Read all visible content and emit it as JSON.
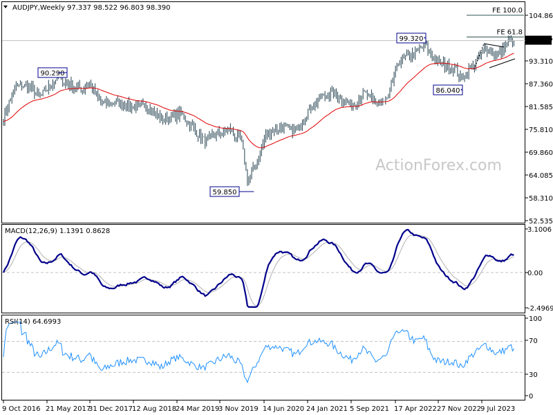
{
  "header": {
    "symbol": "AUDJPY,Weekly",
    "ohlc": "97.337 98.522 96.803 98.390",
    "dropdown_icon": "triangle-down-icon"
  },
  "watermark": "ActionForex.com",
  "colors": {
    "bars": "#24414f",
    "ma": "#e00000",
    "macd": "#00008b",
    "signal": "#b0b0b0",
    "rsi": "#1e90ff",
    "label_border": "#00008b"
  },
  "chart_data": [
    {
      "type": "ohlc",
      "title": "AUDJPY,Weekly",
      "x": [
        "2016-10",
        "2016-12",
        "2017-02",
        "2017-04",
        "2017-07",
        "2017-08",
        "2017-11",
        "2017-12",
        "2018-02",
        "2018-05",
        "2018-08",
        "2018-10",
        "2018-12",
        "2019-03",
        "2019-05",
        "2019-07",
        "2019-09",
        "2019-11",
        "2020-01",
        "2020-02",
        "2020-04",
        "2020-05",
        "2020-07",
        "2020-10",
        "2020-12",
        "2021-02",
        "2021-04",
        "2021-05",
        "2021-07",
        "2021-09",
        "2021-11",
        "2022-01",
        "2022-02",
        "2022-03",
        "2022-05",
        "2022-07",
        "2022-09",
        "2022-12",
        "2023-01",
        "2023-03",
        "2023-05",
        "2023-07",
        "2023-08",
        "2023-09"
      ],
      "close": [
        78.8,
        86.8,
        86.8,
        84.0,
        89.4,
        87.6,
        85.9,
        87.6,
        82.4,
        82.4,
        81.5,
        81.5,
        78.0,
        79.7,
        76.2,
        72.7,
        74.4,
        75.7,
        72.7,
        62.2,
        69.2,
        74.4,
        76.2,
        75.3,
        80.6,
        84.0,
        85.0,
        84.0,
        81.5,
        85.0,
        82.4,
        83.2,
        89.4,
        93.8,
        94.7,
        97.3,
        92.9,
        91.2,
        88.5,
        92.0,
        96.4,
        94.7,
        96.4,
        98.39
      ],
      "overlay": "moving average (red)",
      "ylim": [
        52.535,
        104.86
      ],
      "y_ticks": [
        "104.860",
        "99.285",
        "93.310",
        "87.360",
        "81.585",
        "75.810",
        "69.860",
        "64.085",
        "58.310",
        "52.535"
      ],
      "x_ticks": [
        "9 Oct 2016",
        "21 May 2017",
        "31 Dec 2017",
        "12 Aug 2018",
        "24 Mar 2019",
        "3 Nov 2019",
        "14 Jun 2020",
        "24 Jan 2021",
        "5 Sep 2021",
        "17 Apr 2022",
        "27 Nov 2022",
        "9 Jul 2023"
      ],
      "current_price": "98.390",
      "annotations": [
        {
          "text": "90.290",
          "value": 90.29,
          "date": "2017-07"
        },
        {
          "text": "59.850",
          "value": 59.85,
          "date": "2020-03"
        },
        {
          "text": "99.320",
          "value": 99.32,
          "date": "2022-07"
        },
        {
          "text": "86.040",
          "value": 86.04,
          "date": "2023-01"
        }
      ],
      "levels": [
        {
          "text": "FE 100.0",
          "value": 104.86
        },
        {
          "text": "FE 61.8",
          "value": 99.29
        }
      ]
    },
    {
      "type": "line",
      "title": "MACD(12,26,9) 1.1391 0.8628",
      "series": [
        {
          "name": "MACD"
        },
        {
          "name": "Signal"
        }
      ],
      "ylim": [
        -2.4969,
        3.1006
      ],
      "y_ticks": [
        "3.1006",
        "0.00",
        "-2.4969"
      ]
    },
    {
      "type": "line",
      "title": "RSI(14) 64.6993",
      "ylim": [
        0,
        100
      ],
      "y_ticks": [
        "100",
        "70",
        "30",
        "0"
      ]
    }
  ]
}
